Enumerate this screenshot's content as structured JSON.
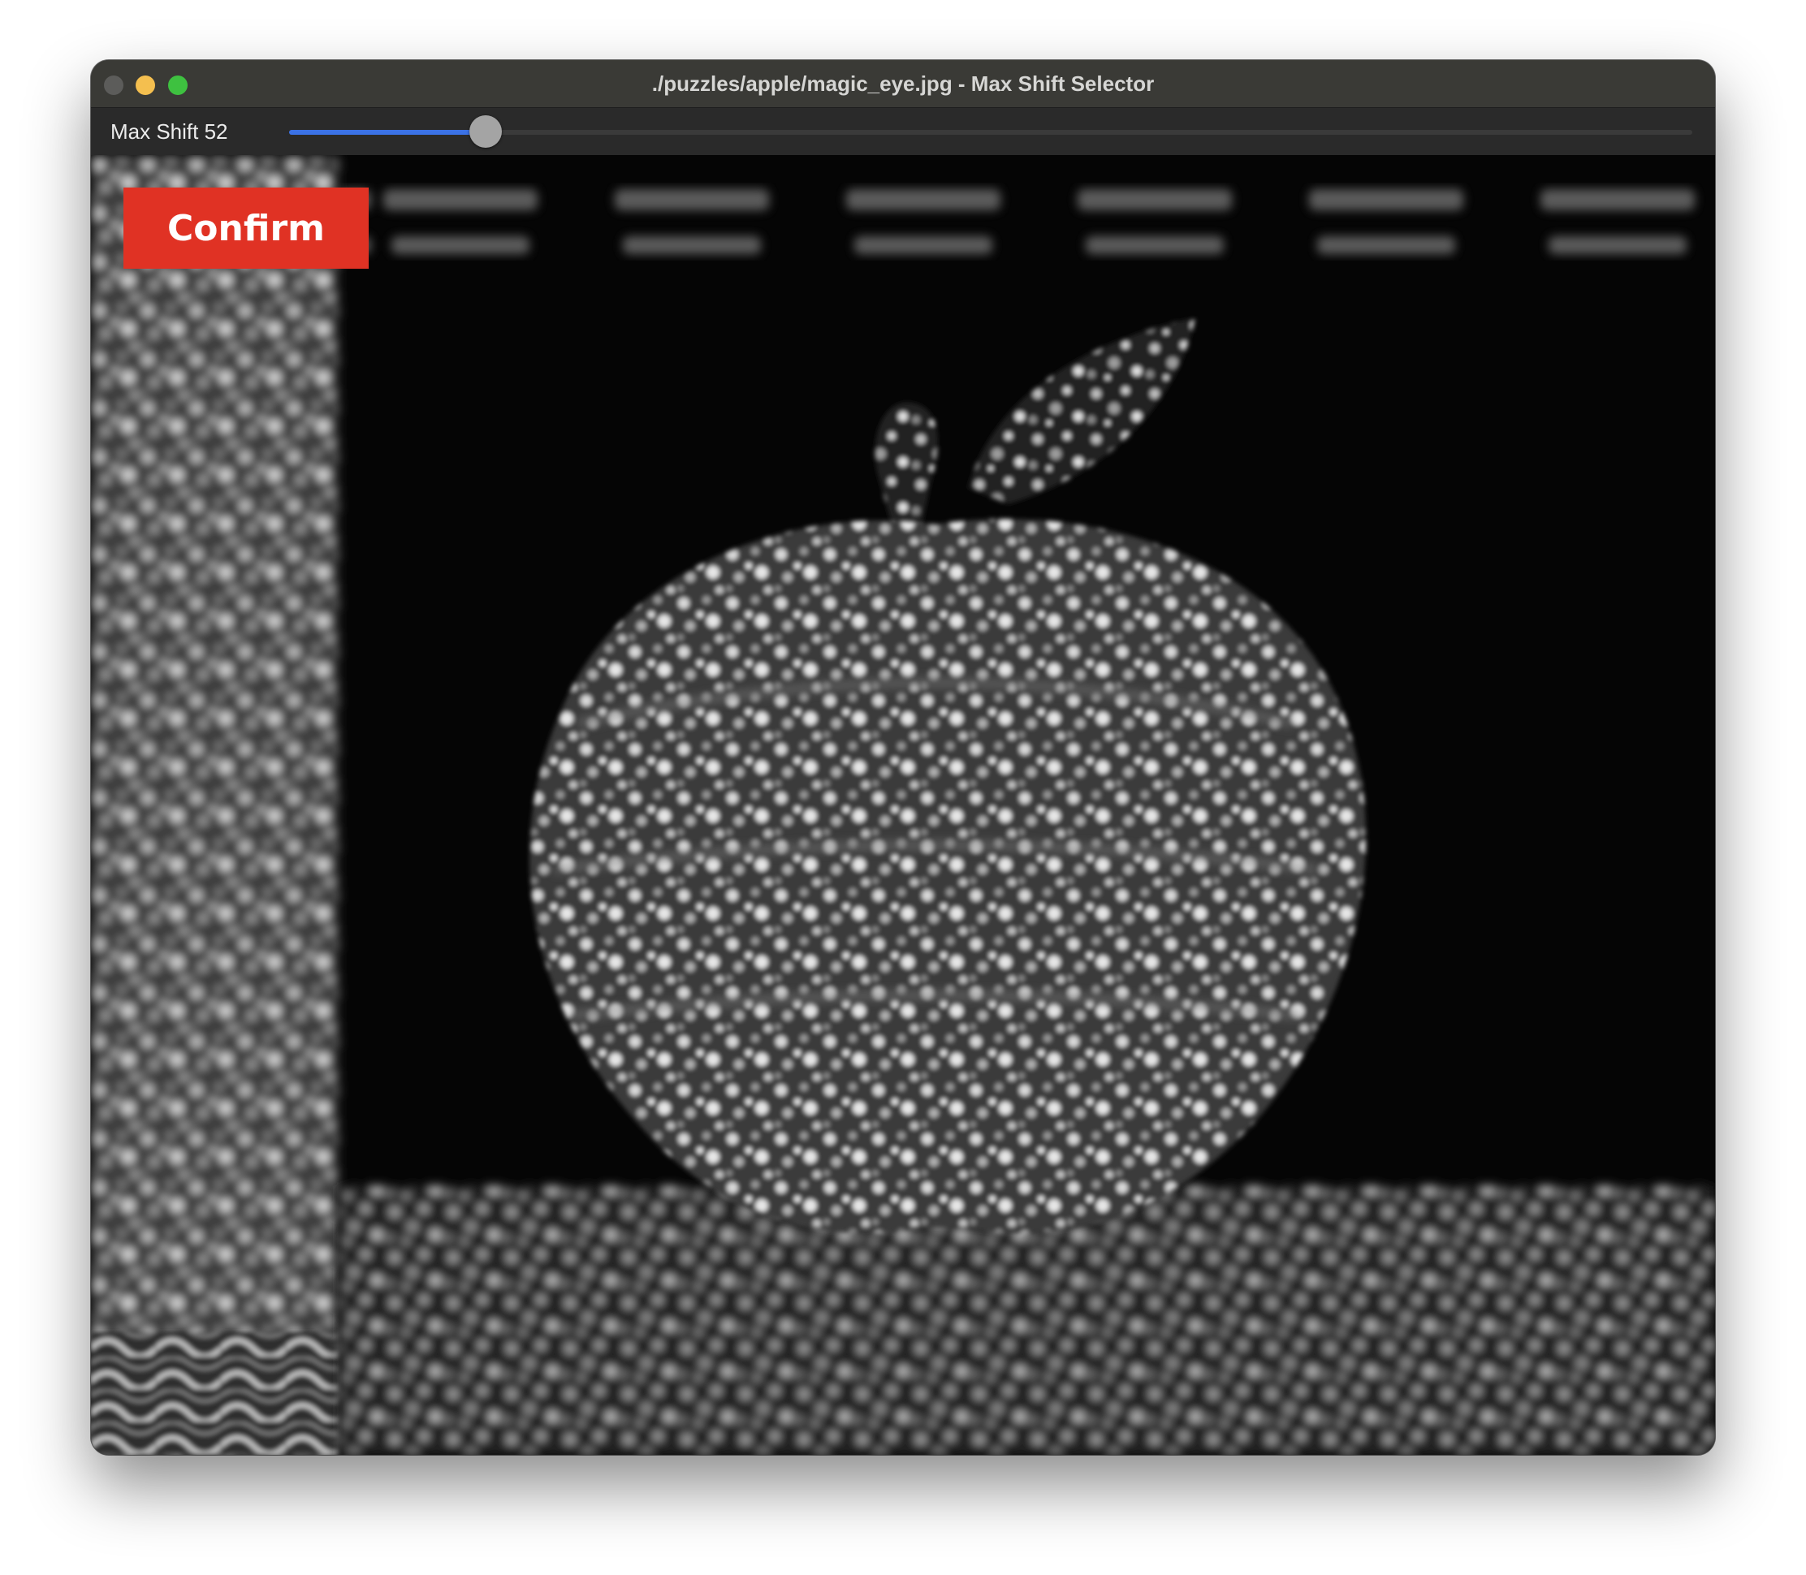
{
  "window": {
    "title": "./puzzles/apple/magic_eye.jpg - Max Shift Selector"
  },
  "toolbar": {
    "max_shift_label": "Max Shift 52",
    "slider_value_fraction": 0.14
  },
  "canvas": {
    "image_description_icon": "autostereogram-apple-icon",
    "confirm_label": "Confirm"
  },
  "colors": {
    "confirm_button": "#e03224",
    "slider_fill": "#3b72e6"
  }
}
